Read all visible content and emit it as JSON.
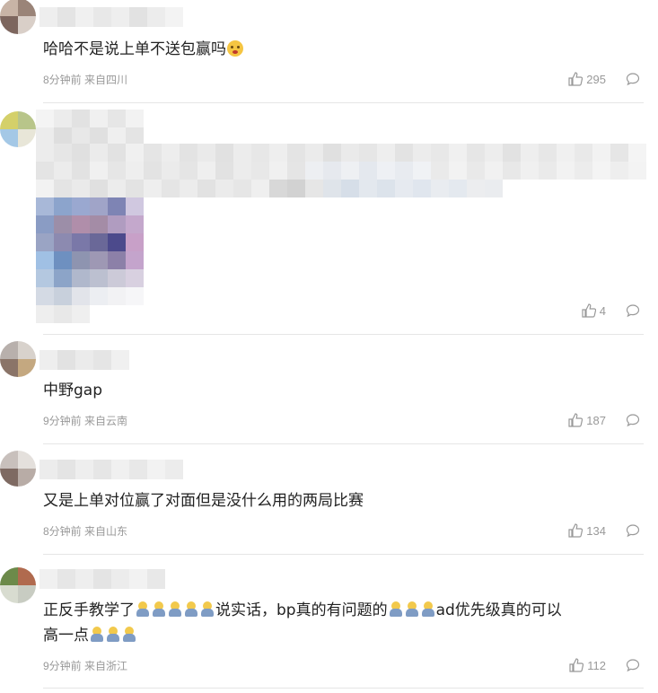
{
  "comments": [
    {
      "text": "哈哈不是说上单不送包赢吗",
      "emoji_end": "face-emoji",
      "time": "8分钟前",
      "location": "来自四川",
      "likes": "295"
    },
    {
      "text": "",
      "time": "",
      "location": "",
      "likes": "4"
    },
    {
      "text": "中野gap",
      "time": "9分钟前",
      "location": "来自云南",
      "likes": "187"
    },
    {
      "text": "又是上单对位赢了对面但是没什么用的两局比赛",
      "time": "8分钟前",
      "location": "来自山东",
      "likes": "134"
    },
    {
      "text_a": "正反手教学了",
      "text_b": "说实话，bp真的有问题的",
      "text_c": "ad优先级真的可以",
      "text_d": "高一点",
      "time": "9分钟前",
      "location": "来自浙江",
      "likes": "112"
    }
  ],
  "icons": {
    "like": "thumbs-up-icon",
    "reply": "comment-bubble-icon",
    "emoji": "thinking-person-emoji"
  },
  "colors": {
    "meta": "#999999",
    "text": "#222222",
    "divider": "#e6e6e6"
  }
}
